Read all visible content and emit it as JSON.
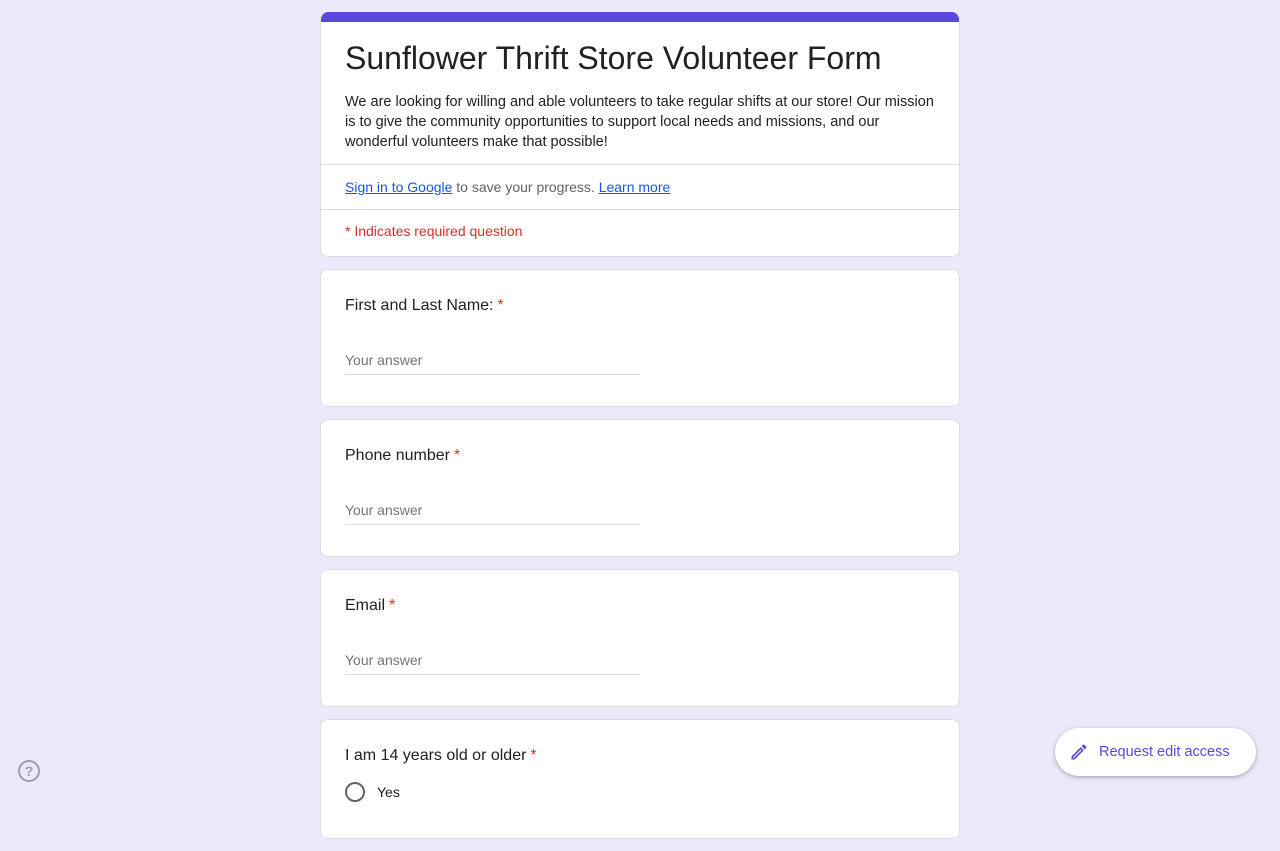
{
  "form": {
    "title": "Sunflower Thrift Store Volunteer Form",
    "description": "We are looking for willing and able volunteers to take regular shifts at our store! Our mission is to give the community opportunities to support local needs and missions, and our wonderful volunteers make that possible!",
    "signin_link": "Sign in to Google",
    "signin_text": " to save your progress. ",
    "learn_more": "Learn more",
    "required_note": "* Indicates required question",
    "accent_color": "#5b47e0"
  },
  "questions": [
    {
      "title": "First and Last Name:",
      "required_mark": "*",
      "placeholder": "Your answer"
    },
    {
      "title": "Phone number",
      "required_mark": "*",
      "placeholder": "Your answer"
    },
    {
      "title": "Email",
      "required_mark": "*",
      "placeholder": "Your answer"
    },
    {
      "title": "I am 14 years old or older",
      "required_mark": "*",
      "options": [
        "Yes"
      ]
    }
  ],
  "floating": {
    "edit_access_label": "Request edit access",
    "edit_icon": "pencil-icon",
    "help_icon": "help-circle-icon",
    "help_glyph": "?"
  }
}
